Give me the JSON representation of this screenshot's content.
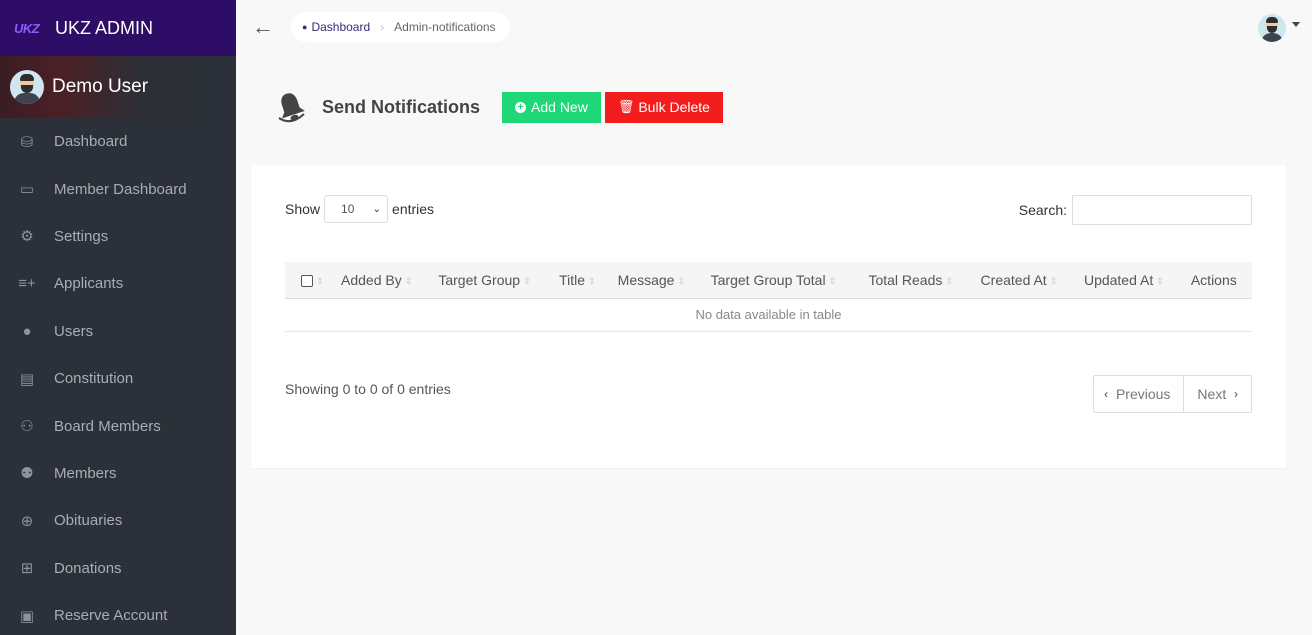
{
  "brand": {
    "logo_text": "UKZ",
    "title": "UKZ ADMIN"
  },
  "user": {
    "name": "Demo User"
  },
  "sidebar": {
    "items": [
      {
        "label": "Dashboard",
        "icon": "dashboard-icon",
        "glyph": "⛁"
      },
      {
        "label": "Member Dashboard",
        "icon": "window-icon",
        "glyph": "▭"
      },
      {
        "label": "Settings",
        "icon": "gear-icon",
        "glyph": "⚙"
      },
      {
        "label": "Applicants",
        "icon": "list-add-icon",
        "glyph": "≡+"
      },
      {
        "label": "Users",
        "icon": "user-icon",
        "glyph": "●"
      },
      {
        "label": "Constitution",
        "icon": "book-icon",
        "glyph": "▤"
      },
      {
        "label": "Board Members",
        "icon": "group-icon",
        "glyph": "⚇"
      },
      {
        "label": "Members",
        "icon": "users-icon",
        "glyph": "⚉"
      },
      {
        "label": "Obituaries",
        "icon": "cross-circle-icon",
        "glyph": "⊕"
      },
      {
        "label": "Donations",
        "icon": "gift-icon",
        "glyph": "⊞"
      },
      {
        "label": "Reserve Account",
        "icon": "wallet-icon",
        "glyph": "▣"
      }
    ]
  },
  "breadcrumb": {
    "home": "Dashboard",
    "separator": "›",
    "current": "Admin-notifications"
  },
  "page": {
    "title": "Send Notifications",
    "add_label": "Add New",
    "bulk_delete_label": "Bulk Delete"
  },
  "table_controls": {
    "show_label": "Show",
    "page_size": "10",
    "entries_label": "entries",
    "search_label": "Search:"
  },
  "table": {
    "columns": [
      "Added By",
      "Target Group",
      "Title",
      "Message",
      "Target Group Total",
      "Total Reads",
      "Created At",
      "Updated At",
      "Actions"
    ],
    "empty_message": "No data available in table"
  },
  "footer": {
    "info": "Showing 0 to 0 of 0 entries",
    "prev_label": "Previous",
    "next_label": "Next"
  },
  "colors": {
    "brand_bg": "#2e0d66",
    "sidebar_bg": "#2c3038",
    "add_button": "#1fd776",
    "delete_button": "#f41d1d"
  }
}
